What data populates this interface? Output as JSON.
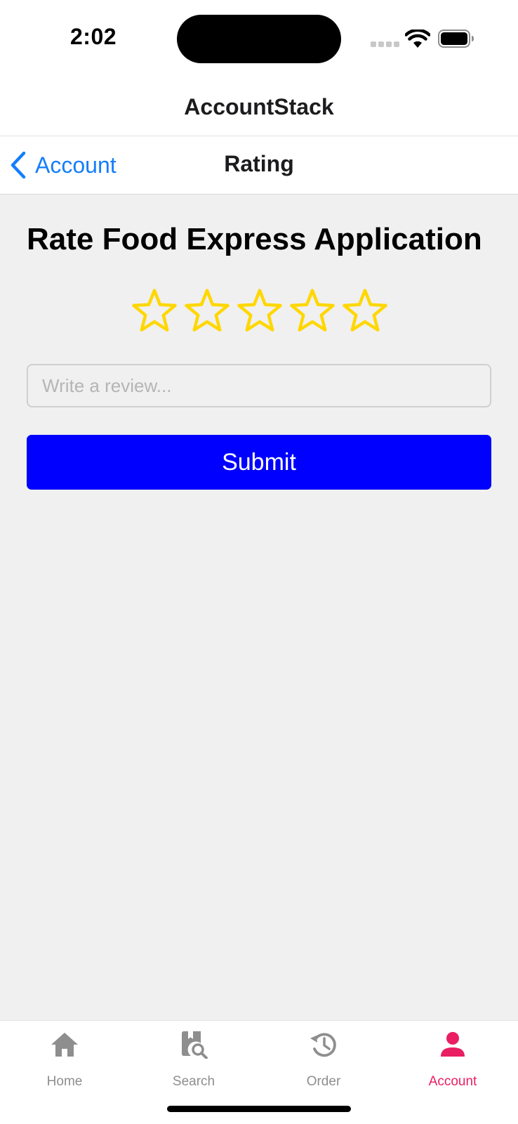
{
  "status_bar": {
    "time": "2:02"
  },
  "stack_header": {
    "title": "AccountStack"
  },
  "nav": {
    "back_label": "Account",
    "title": "Rating"
  },
  "rating": {
    "heading": "Rate Food Express Application",
    "max_stars": 5,
    "selected_stars": 0,
    "star_color": "#FFD700"
  },
  "review": {
    "placeholder": "Write a review...",
    "value": ""
  },
  "submit": {
    "label": "Submit",
    "color": "#0000FF"
  },
  "tab_bar": {
    "active_color": "#E91E63",
    "inactive_color": "#8E8E8E",
    "tabs": [
      {
        "label": "Home",
        "icon": "home-icon",
        "active": false
      },
      {
        "label": "Search",
        "icon": "book-search-icon",
        "active": false
      },
      {
        "label": "Order",
        "icon": "history-icon",
        "active": false
      },
      {
        "label": "Account",
        "icon": "person-icon",
        "active": true
      }
    ]
  }
}
